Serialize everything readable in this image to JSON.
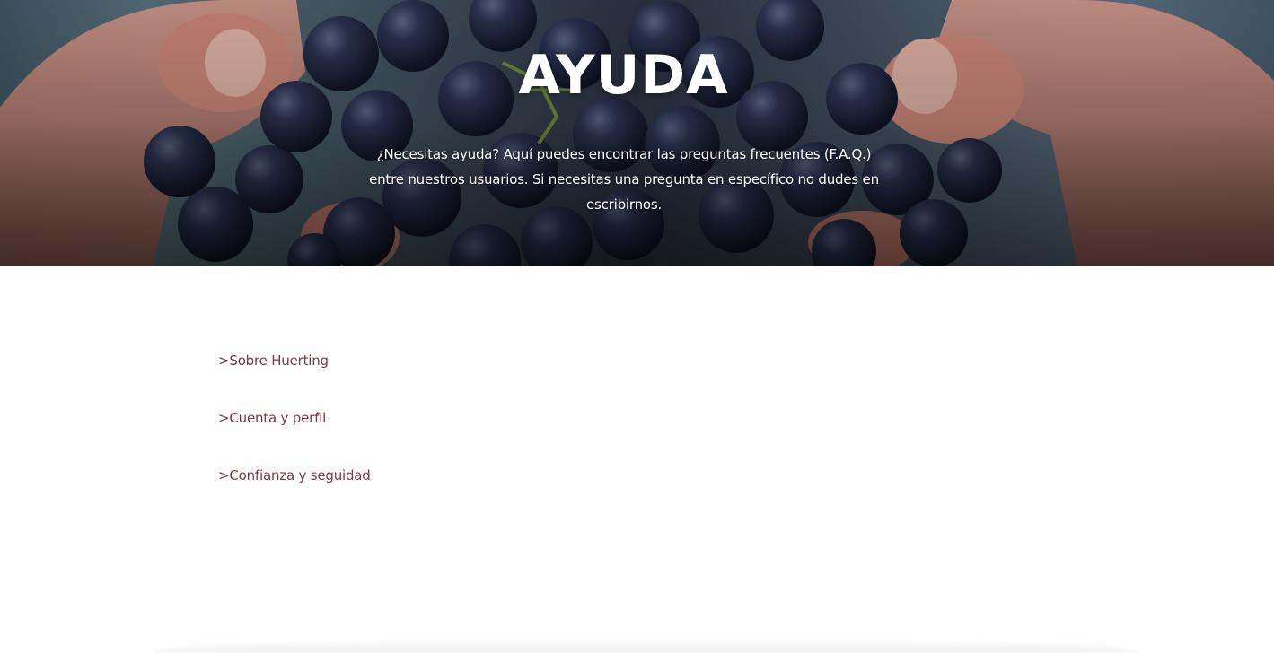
{
  "hero": {
    "title": "AYUDA",
    "description": "¿Necesitas ayuda? Aquí puedes encontrar las preguntas frecuentes (F.A.Q.) entre nuestros usuarios. Si necesitas una pregunta en específico no dudes en escribirnos.",
    "image": "grapes-in-hands-photo"
  },
  "faq": {
    "items": [
      {
        "label": ">Sobre Huerting"
      },
      {
        "label": ">Cuenta y perfil"
      },
      {
        "label": ">Confianza y seguidad"
      }
    ]
  },
  "colors": {
    "link": "#7a3b40",
    "hero_text": "#ffffff",
    "background": "#ffffff"
  }
}
